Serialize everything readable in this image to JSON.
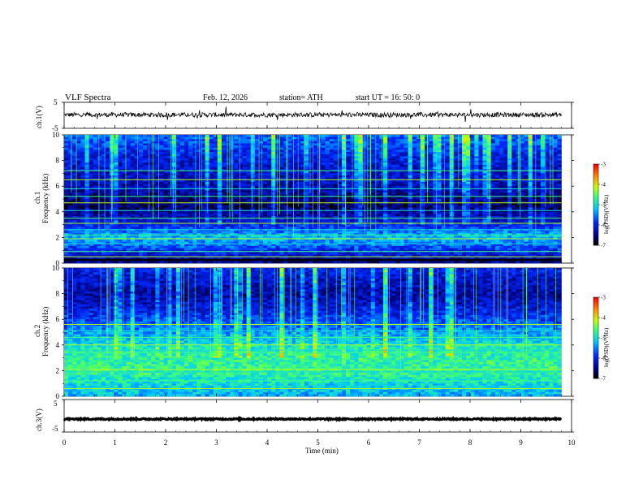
{
  "header": {
    "title": "VLF Spectra",
    "date": "Feb. 12, 2026",
    "station": "station= ATH",
    "start": "start UT = 16: 50: 0"
  },
  "chart_data": [
    {
      "type": "line",
      "name": "ch1-waveform",
      "ylabel": "ch.1(V)",
      "ylim": [
        -5,
        5
      ],
      "yticks": [
        "5",
        "-5"
      ],
      "xlim": [
        0,
        10
      ],
      "data_end_min": 9.8,
      "baseline_v": 0.2,
      "noise_amplitude_v": 0.9,
      "color": "#000000"
    },
    {
      "type": "heatmap",
      "name": "ch1-spectrogram",
      "ylabel": "Frequency (kHz)",
      "channel_label": "ch.1",
      "ylim": [
        0,
        10
      ],
      "yticks": [
        "10",
        "8",
        "6",
        "4",
        "2",
        "0"
      ],
      "xlim": [
        0,
        10
      ],
      "data_end_min": 9.8,
      "colorbar": {
        "label": "log(PSD)(V²/Hz)",
        "ticks": [
          "-3",
          "-4",
          "-5",
          "-6",
          "-7"
        ],
        "range": [
          -7,
          -3
        ]
      },
      "background_levels": [
        {
          "f": 10,
          "level": -5.6
        },
        {
          "f": 8,
          "level": -6.1
        },
        {
          "f": 6,
          "level": -6.3
        },
        {
          "f": 4.5,
          "level": -6.7
        },
        {
          "f": 3,
          "level": -6.0
        },
        {
          "f": 2,
          "level": -5.2
        },
        {
          "f": 1,
          "level": -5.9
        },
        {
          "f": 0,
          "level": -6.5
        }
      ],
      "lines_khz": [
        0.5,
        0.9,
        1.5,
        1.9,
        2.2,
        2.6,
        3.1,
        3.5,
        4.1,
        4.7,
        5.2,
        5.8,
        6.5,
        7.2
      ],
      "gap_khz": [
        0.1,
        0.25
      ]
    },
    {
      "type": "heatmap",
      "name": "ch2-spectrogram",
      "ylabel": "Frequency (kHz)",
      "channel_label": "ch.2",
      "ylim": [
        0,
        10
      ],
      "yticks": [
        "10",
        "8",
        "6",
        "4",
        "2",
        "0"
      ],
      "xlim": [
        0,
        10
      ],
      "data_end_min": 9.8,
      "colorbar": {
        "label": "log(PSD)(V²/Hz)",
        "ticks": [
          "-3",
          "-4",
          "-5",
          "-6",
          "-7"
        ],
        "range": [
          -7,
          -3
        ]
      },
      "background_levels": [
        {
          "f": 10,
          "level": -6.0
        },
        {
          "f": 8,
          "level": -6.4
        },
        {
          "f": 6.5,
          "level": -6.0
        },
        {
          "f": 5,
          "level": -5.4
        },
        {
          "f": 3.5,
          "level": -4.8
        },
        {
          "f": 2,
          "level": -4.7
        },
        {
          "f": 1,
          "level": -5.0
        },
        {
          "f": 0,
          "level": -5.3
        }
      ],
      "lines_khz": [
        0.6,
        1.2,
        1.9,
        2.1,
        3.4,
        3.6,
        4.0,
        4.6,
        5.1,
        5.6
      ],
      "gap_khz": [
        0.1,
        0.2
      ]
    },
    {
      "type": "line",
      "name": "ch3-waveform",
      "ylabel": "ch.3(V)",
      "ylim": [
        -5,
        5
      ],
      "yticks": [
        "5",
        "-5"
      ],
      "xlim": [
        0,
        10
      ],
      "data_end_min": 9.8,
      "baseline_v": -1.0,
      "noise_amplitude_v": 0.2,
      "color": "#000000"
    }
  ],
  "xaxis": {
    "label": "Time (min)",
    "ticks": [
      "0",
      "1",
      "2",
      "3",
      "4",
      "5",
      "6",
      "7",
      "8",
      "9",
      "10"
    ]
  }
}
